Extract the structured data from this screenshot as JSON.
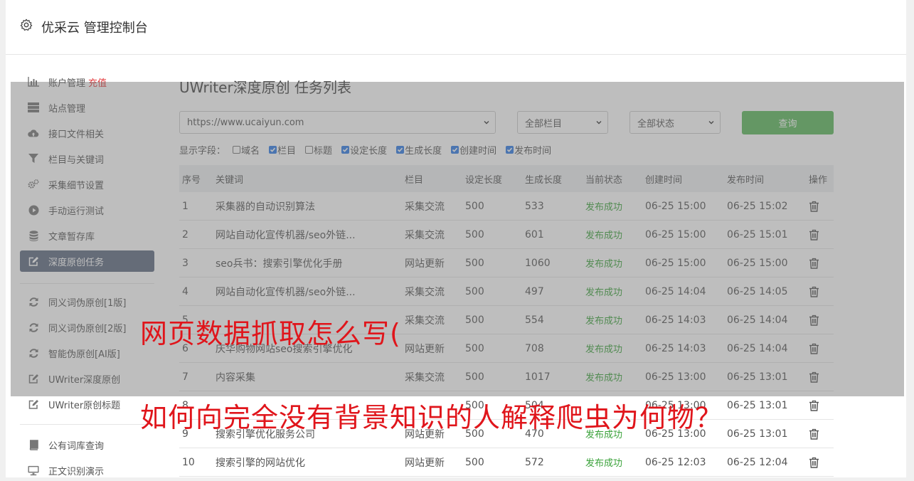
{
  "header": {
    "title": "优采云 管理控制台"
  },
  "sidebar": {
    "items": [
      {
        "label": "账户管理",
        "badge": "充值",
        "icon": "bar-chart-icon"
      },
      {
        "label": "站点管理",
        "icon": "server-icon"
      },
      {
        "label": "接口文件相关",
        "icon": "cloud-upload-icon"
      },
      {
        "label": "栏目与关键词",
        "icon": "filter-icon"
      },
      {
        "label": "采集细节设置",
        "icon": "gears-icon"
      },
      {
        "label": "手动运行测试",
        "icon": "play-circle-icon"
      },
      {
        "label": "文章暂存库",
        "icon": "database-icon"
      },
      {
        "label": "深度原创任务",
        "icon": "edit-icon"
      },
      {
        "label": "同义词伪原创[1版]",
        "icon": "refresh-icon"
      },
      {
        "label": "同义词伪原创[2版]",
        "icon": "refresh-icon"
      },
      {
        "label": "智能伪原创[AI版]",
        "icon": "refresh-icon"
      },
      {
        "label": "UWriter深度原创",
        "icon": "edit-icon"
      },
      {
        "label": "UWriter原创标题",
        "icon": "edit-icon"
      },
      {
        "label": "公有词库查询",
        "icon": "book-icon"
      },
      {
        "label": "正文识别演示",
        "icon": "desktop-icon"
      }
    ]
  },
  "main": {
    "title": "UWriter深度原创 任务列表",
    "filters": {
      "site": "https://www.ucaiyun.com",
      "column": "全部栏目",
      "status": "全部状态",
      "query_label": "查询"
    },
    "fields": {
      "label": "显示字段：",
      "options": [
        {
          "label": "域名",
          "checked": false
        },
        {
          "label": "栏目",
          "checked": true
        },
        {
          "label": "标题",
          "checked": false
        },
        {
          "label": "设定长度",
          "checked": true
        },
        {
          "label": "生成长度",
          "checked": true
        },
        {
          "label": "创建时间",
          "checked": true
        },
        {
          "label": "发布时间",
          "checked": true
        }
      ]
    },
    "table": {
      "headers": [
        "序号",
        "关键词",
        "栏目",
        "设定长度",
        "生成长度",
        "当前状态",
        "创建时间",
        "发布时间",
        "操作"
      ],
      "rows": [
        [
          "1",
          "采集器的自动识别算法",
          "采集交流",
          "500",
          "533",
          "发布成功",
          "06-25 15:00",
          "06-25 15:02"
        ],
        [
          "2",
          "网站自动化宣传机器/seo外链...",
          "采集交流",
          "500",
          "601",
          "发布成功",
          "06-25 15:00",
          "06-25 15:01"
        ],
        [
          "3",
          "seo兵书：搜索引擎优化手册",
          "网站更新",
          "500",
          "1060",
          "发布成功",
          "06-25 15:00",
          "06-25 15:00"
        ],
        [
          "4",
          "网站自动化宣传机器/seo外链...",
          "采集交流",
          "500",
          "497",
          "发布成功",
          "06-25 14:04",
          "06-25 14:05"
        ],
        [
          "5",
          "",
          "采集交流",
          "500",
          "554",
          "发布成功",
          "06-25 14:03",
          "06-25 14:04"
        ],
        [
          "6",
          "庆华购物网站seo搜索引擎优化",
          "网站更新",
          "500",
          "708",
          "发布成功",
          "06-25 14:03",
          "06-25 14:04"
        ],
        [
          "7",
          "内容采集",
          "采集交流",
          "500",
          "1017",
          "发布成功",
          "06-25 13:00",
          "06-25 13:01"
        ],
        [
          "8",
          "",
          "",
          "500",
          "504",
          "",
          "06-25 13:00",
          "06-25 13:01"
        ],
        [
          "9",
          "搜索引擎优化服务公司",
          "网站更新",
          "500",
          "470",
          "发布成功",
          "06-25 13:00",
          "06-25 13:01"
        ],
        [
          "10",
          "搜索引擎的网站优化",
          "网站更新",
          "500",
          "572",
          "发布成功",
          "06-25 12:03",
          "06-25 12:04"
        ]
      ]
    }
  },
  "overlay": {
    "line1": "网页数据抓取怎么写(",
    "line2": "如何向完全没有背景知识的人解释爬虫为何物？",
    "color": "#e0151b"
  }
}
